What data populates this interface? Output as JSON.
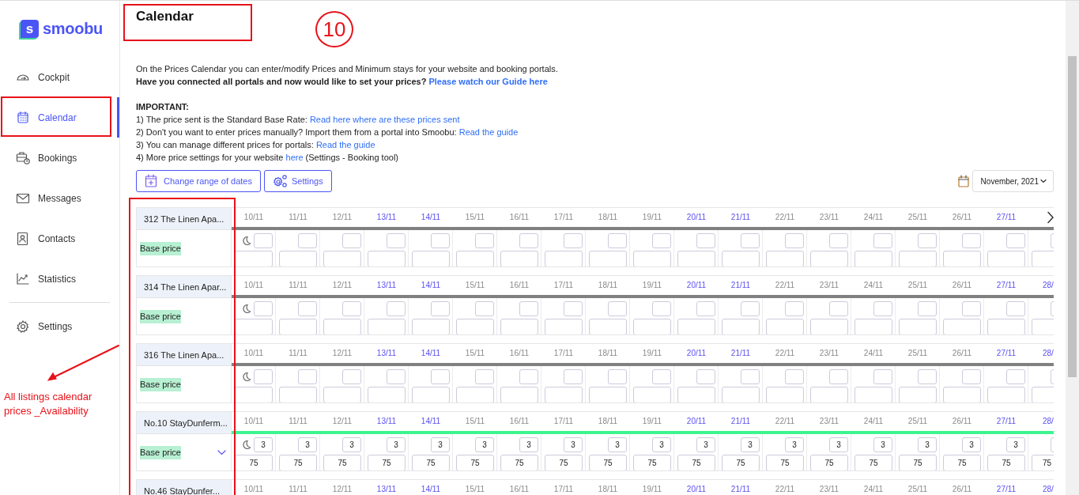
{
  "sidebar": {
    "logo_mark": "s",
    "logo": "smoobu",
    "items": [
      {
        "label": "Cockpit",
        "selected": false
      },
      {
        "label": "Calendar",
        "selected": true
      },
      {
        "label": "Bookings",
        "selected": false
      },
      {
        "label": "Messages",
        "selected": false
      },
      {
        "label": "Contacts",
        "selected": false
      },
      {
        "label": "Statistics",
        "selected": false
      }
    ],
    "footer_items": [
      {
        "label": "Settings",
        "selected": false
      }
    ]
  },
  "title": "Calendar",
  "intro": "On the Prices Calendar you can enter/modify Prices and Minimum stays for your website and booking portals.",
  "question": {
    "text": "Have you connected all portals and now would like to set your prices?",
    "link": "Please watch our Guide here"
  },
  "important_heading": "IMPORTANT:",
  "notes": [
    {
      "text": "1) The price sent is the Standard Base Rate:",
      "link": "Read here where are these prices sent"
    },
    {
      "text": "2) Don't you want to enter prices manually? Import them from a portal into Smoobu:",
      "link": "Read the guide"
    },
    {
      "text": "3) You can manage different prices for portals:",
      "link": "Read the guide"
    },
    {
      "text": "4) More price settings for your website",
      "link": "here",
      "after": "(Settings - Booking tool)"
    }
  ],
  "toolbar": [
    {
      "label": "Change range of dates"
    },
    {
      "label": "Settings"
    }
  ],
  "month_picker": {
    "value": "November, 2021"
  },
  "calendar": {
    "listings": [
      {
        "name": "312 The Linen Apa...",
        "rate_label": "Base price",
        "color": "#808080",
        "next_arrow": true,
        "dropdown": false,
        "dates": [
          {
            "label": "10/11",
            "weekend": false
          },
          {
            "label": "11/11",
            "weekend": false
          },
          {
            "label": "12/11",
            "weekend": false
          },
          {
            "label": "13/11",
            "weekend": true
          },
          {
            "label": "14/11",
            "weekend": true
          },
          {
            "label": "15/11",
            "weekend": false
          },
          {
            "label": "16/11",
            "weekend": false
          },
          {
            "label": "17/11",
            "weekend": false
          },
          {
            "label": "18/11",
            "weekend": false
          },
          {
            "label": "19/11",
            "weekend": false
          },
          {
            "label": "20/11",
            "weekend": true
          },
          {
            "label": "21/11",
            "weekend": true
          },
          {
            "label": "22/11",
            "weekend": false
          },
          {
            "label": "23/11",
            "weekend": false
          },
          {
            "label": "24/11",
            "weekend": false
          },
          {
            "label": "25/11",
            "weekend": false
          },
          {
            "label": "26/11",
            "weekend": false
          },
          {
            "label": "27/11",
            "weekend": true
          }
        ]
      },
      {
        "name": "314 The Linen Apar...",
        "rate_label": "Base price",
        "color": "#808080",
        "next_arrow": false,
        "dropdown": false,
        "dates": [
          {
            "label": "10/11",
            "weekend": false
          },
          {
            "label": "11/11",
            "weekend": false
          },
          {
            "label": "12/11",
            "weekend": false
          },
          {
            "label": "13/11",
            "weekend": true
          },
          {
            "label": "14/11",
            "weekend": true
          },
          {
            "label": "15/11",
            "weekend": false
          },
          {
            "label": "16/11",
            "weekend": false
          },
          {
            "label": "17/11",
            "weekend": false
          },
          {
            "label": "18/11",
            "weekend": false
          },
          {
            "label": "19/11",
            "weekend": false
          },
          {
            "label": "20/11",
            "weekend": true
          },
          {
            "label": "21/11",
            "weekend": true
          },
          {
            "label": "22/11",
            "weekend": false
          },
          {
            "label": "23/11",
            "weekend": false
          },
          {
            "label": "24/11",
            "weekend": false
          },
          {
            "label": "25/11",
            "weekend": false
          },
          {
            "label": "26/11",
            "weekend": false
          },
          {
            "label": "27/11",
            "weekend": true
          },
          {
            "label": "28/",
            "weekend": true
          }
        ]
      },
      {
        "name": "316 The Linen Apa...",
        "rate_label": "Base price",
        "color": "#808080",
        "next_arrow": false,
        "dropdown": false,
        "dates": [
          {
            "label": "10/11",
            "weekend": false
          },
          {
            "label": "11/11",
            "weekend": false
          },
          {
            "label": "12/11",
            "weekend": false
          },
          {
            "label": "13/11",
            "weekend": true
          },
          {
            "label": "14/11",
            "weekend": true
          },
          {
            "label": "15/11",
            "weekend": false
          },
          {
            "label": "16/11",
            "weekend": false
          },
          {
            "label": "17/11",
            "weekend": false
          },
          {
            "label": "18/11",
            "weekend": false
          },
          {
            "label": "19/11",
            "weekend": false
          },
          {
            "label": "20/11",
            "weekend": true
          },
          {
            "label": "21/11",
            "weekend": true
          },
          {
            "label": "22/11",
            "weekend": false
          },
          {
            "label": "23/11",
            "weekend": false
          },
          {
            "label": "24/11",
            "weekend": false
          },
          {
            "label": "25/11",
            "weekend": false
          },
          {
            "label": "26/11",
            "weekend": false
          },
          {
            "label": "27/11",
            "weekend": true
          },
          {
            "label": "28/",
            "weekend": true
          }
        ]
      },
      {
        "name": "No.10 StayDunferm...",
        "rate_label": "Base price",
        "color": "#3df58e",
        "next_arrow": false,
        "dropdown": true,
        "dates": [
          {
            "label": "10/11",
            "weekend": false
          },
          {
            "label": "11/11",
            "weekend": false
          },
          {
            "label": "12/11",
            "weekend": false
          },
          {
            "label": "13/11",
            "weekend": true
          },
          {
            "label": "14/11",
            "weekend": true
          },
          {
            "label": "15/11",
            "weekend": false
          },
          {
            "label": "16/11",
            "weekend": false
          },
          {
            "label": "17/11",
            "weekend": false
          },
          {
            "label": "18/11",
            "weekend": false
          },
          {
            "label": "19/11",
            "weekend": false
          },
          {
            "label": "20/11",
            "weekend": true
          },
          {
            "label": "21/11",
            "weekend": true
          },
          {
            "label": "22/11",
            "weekend": false
          },
          {
            "label": "23/11",
            "weekend": false
          },
          {
            "label": "24/11",
            "weekend": false
          },
          {
            "label": "25/11",
            "weekend": false
          },
          {
            "label": "26/11",
            "weekend": false
          },
          {
            "label": "27/11",
            "weekend": true
          },
          {
            "label": "28/",
            "weekend": true
          }
        ],
        "cells": [
          {
            "min_stay": "3",
            "price": "75"
          },
          {
            "min_stay": "3",
            "price": "75"
          },
          {
            "min_stay": "3",
            "price": "75"
          },
          {
            "min_stay": "3",
            "price": "75"
          },
          {
            "min_stay": "3",
            "price": "75"
          },
          {
            "min_stay": "3",
            "price": "75"
          },
          {
            "min_stay": "3",
            "price": "75"
          },
          {
            "min_stay": "3",
            "price": "75"
          },
          {
            "min_stay": "3",
            "price": "75"
          },
          {
            "min_stay": "3",
            "price": "75"
          },
          {
            "min_stay": "3",
            "price": "75"
          },
          {
            "min_stay": "3",
            "price": "75"
          },
          {
            "min_stay": "3",
            "price": "75"
          },
          {
            "min_stay": "3",
            "price": "75"
          },
          {
            "min_stay": "3",
            "price": "75"
          },
          {
            "min_stay": "3",
            "price": "75"
          },
          {
            "min_stay": "3",
            "price": "75"
          },
          {
            "min_stay": "3",
            "price": "75"
          },
          {
            "price": "75"
          }
        ]
      },
      {
        "name": "No.46 StayDunfer...",
        "next_arrow": false,
        "dates": [
          {
            "label": "10/11",
            "weekend": false
          },
          {
            "label": "11/11",
            "weekend": false
          },
          {
            "label": "12/11",
            "weekend": false
          },
          {
            "label": "13/11",
            "weekend": true
          },
          {
            "label": "14/11",
            "weekend": true
          },
          {
            "label": "15/11",
            "weekend": false
          },
          {
            "label": "16/11",
            "weekend": false
          },
          {
            "label": "17/11",
            "weekend": false
          },
          {
            "label": "18/11",
            "weekend": false
          },
          {
            "label": "19/11",
            "weekend": false
          },
          {
            "label": "20/11",
            "weekend": true
          },
          {
            "label": "21/11",
            "weekend": true
          },
          {
            "label": "22/11",
            "weekend": false
          },
          {
            "label": "23/11",
            "weekend": false
          },
          {
            "label": "24/11",
            "weekend": false
          },
          {
            "label": "25/11",
            "weekend": false
          },
          {
            "label": "26/11",
            "weekend": false
          },
          {
            "label": "27/11",
            "weekend": true
          },
          {
            "label": "28/",
            "weekend": true
          }
        ]
      }
    ]
  },
  "annotations": {
    "step_number": "10",
    "note": "All listings calendar prices _Availability"
  }
}
